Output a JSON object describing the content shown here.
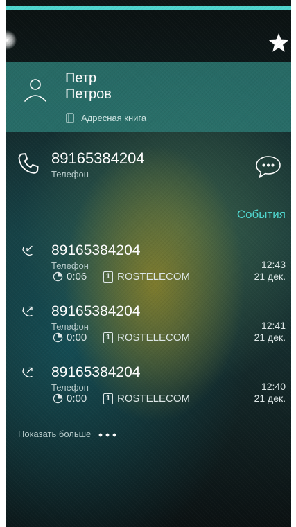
{
  "contact": {
    "first_name": "Петр",
    "last_name": "Петров",
    "source_label": "Адресная книга"
  },
  "phone": {
    "number": "89165384204",
    "type": "Телефон"
  },
  "events": {
    "header": "События",
    "items": [
      {
        "direction": "incoming",
        "icon": "incoming-call-icon",
        "number": "89165384204",
        "type": "Телефон",
        "duration": "0:06",
        "sim": "1",
        "carrier": "ROSTELECOM",
        "time": "12:43",
        "date": "21 дек."
      },
      {
        "direction": "outgoing",
        "icon": "outgoing-call-icon",
        "number": "89165384204",
        "type": "Телефон",
        "duration": "0:00",
        "sim": "1",
        "carrier": "ROSTELECOM",
        "time": "12:41",
        "date": "21 дек."
      },
      {
        "direction": "outgoing",
        "icon": "outgoing-call-icon",
        "number": "89165384204",
        "type": "Телефон",
        "duration": "0:00",
        "sim": "1",
        "carrier": "ROSTELECOM",
        "time": "12:40",
        "date": "21 дек."
      }
    ]
  },
  "show_more": {
    "label": "Показать больше"
  },
  "colors": {
    "accent": "#4fd6cf",
    "contact_card": "#2c7a74",
    "text_primary": "#ffffff",
    "text_secondary": "#b8cccc"
  },
  "icons": {
    "favorite": "star-icon",
    "avatar": "person-icon",
    "address_book": "phone-book-icon",
    "call": "phone-icon",
    "message": "chat-bubble-icon",
    "duration": "timer-icon",
    "sim": "sim-card-icon",
    "more": "dots-icon"
  }
}
